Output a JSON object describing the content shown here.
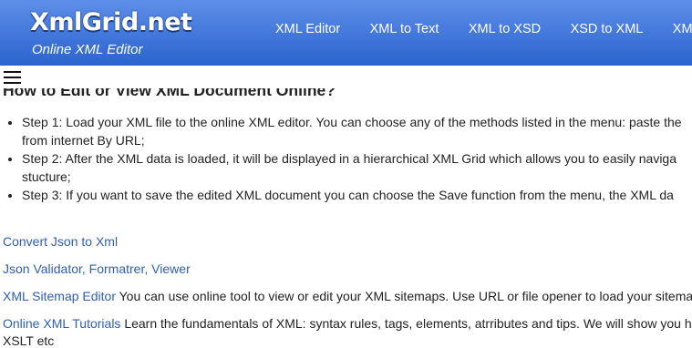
{
  "header": {
    "logo": "XmlGrid.net",
    "tagline": "Online XML Editor",
    "nav": [
      "XML Editor",
      "XML to Text",
      "XML to XSD",
      "XSD to XML",
      "XML to"
    ]
  },
  "content": {
    "heading": "How to Edit or View XML Document Online?",
    "steps": [
      {
        "line1": "Step 1: Load your XML file to the online XML editor. You can choose any of the methods listed in the menu: paste the",
        "line2": "from internet By URL;"
      },
      {
        "line1": "Step 2: After the XML data is loaded, it will be displayed in a hierarchical XML Grid which allows you to easily naviga",
        "line2": "stucture;"
      },
      {
        "line1": "Step 3: If you want to save the edited XML document you can choose the Save function from the menu, the XML da"
      }
    ],
    "links": [
      {
        "link": "Convert Json to Xml",
        "text": ""
      },
      {
        "link": "Json Validator, Formatrer, Viewer",
        "text": ""
      },
      {
        "link": "XML Sitemap Editor",
        "text": " You can use online tool to view or edit your XML sitemaps. Use URL or file opener to load your sitema"
      },
      {
        "link": "Online XML Tutorials",
        "text": " Learn the fundamentals of XML: syntax rules, tags, elements, atrributes and tips. We will show you h"
      }
    ],
    "cutoff_line": "XSLT etc"
  }
}
